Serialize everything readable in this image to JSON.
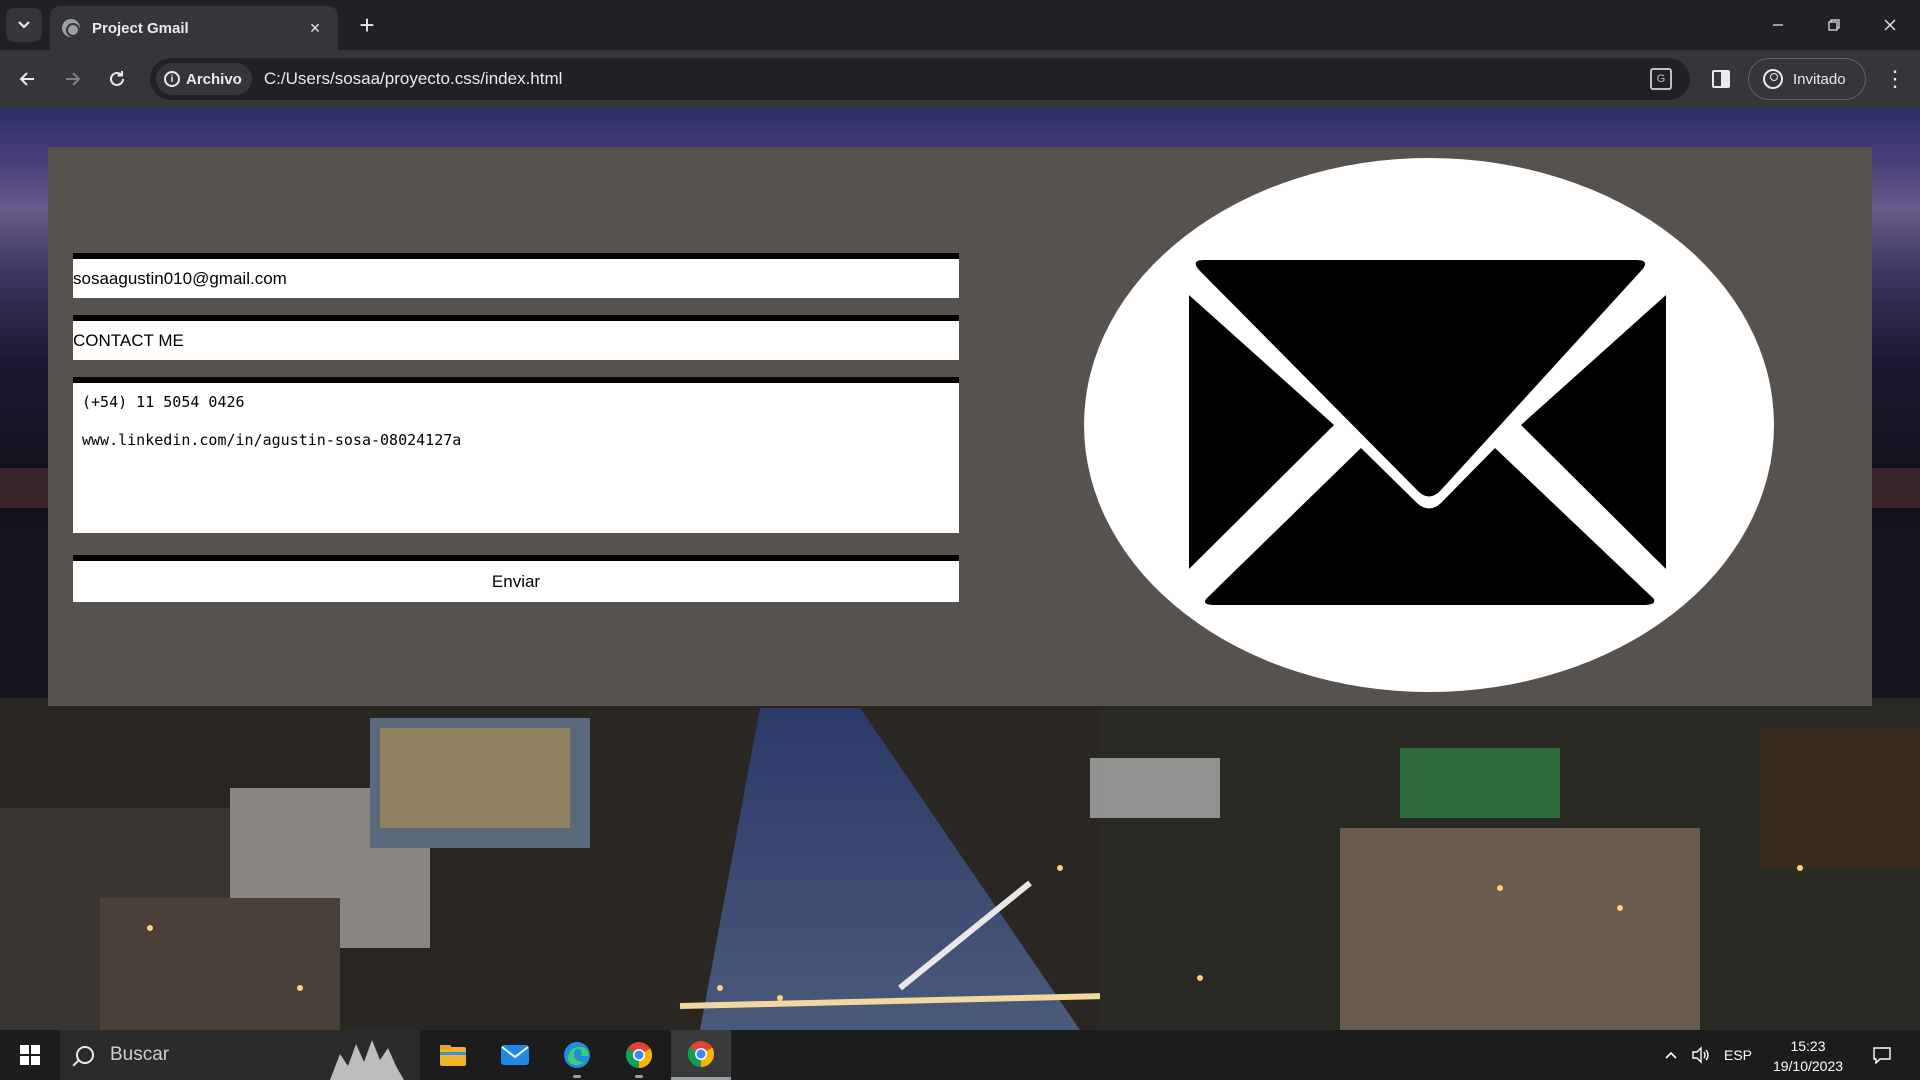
{
  "browser": {
    "tab_title": "Project Gmail",
    "close_glyph": "×",
    "new_tab_glyph": "+",
    "security_chip": "Archivo",
    "url": "C:/Users/sosaa/proyecto.css/index.html",
    "profile_label": "Invitado"
  },
  "form": {
    "email_value": "sosaagustin010@gmail.com",
    "subject_value": "CONTACT ME",
    "message_lines": [
      "(+54) 11 5054 0426",
      "www.linkedin.com/in/agustin-sosa-08024127a"
    ],
    "submit_label": "Enviar"
  },
  "taskbar": {
    "search_label": "Buscar",
    "language": "ESP",
    "time": "15:23",
    "date": "19/10/2023"
  },
  "icons": [
    "tab-search-icon",
    "globe-icon",
    "back-arrow-icon",
    "forward-arrow-icon",
    "reload-icon",
    "info-icon",
    "translate-icon",
    "side-panel-icon",
    "profile-icon",
    "more-menu-icon",
    "mail-envelope-icon",
    "windows-start-icon",
    "search-icon",
    "file-explorer-icon",
    "mail-app-icon",
    "edge-icon",
    "chrome-icon",
    "chevron-up-icon",
    "speaker-icon",
    "notification-icon"
  ],
  "colors": {
    "panel": "#57524d",
    "chrome_dark": "#202124",
    "chrome_toolbar": "#35363a",
    "taskbar": "#1c1c1c"
  }
}
